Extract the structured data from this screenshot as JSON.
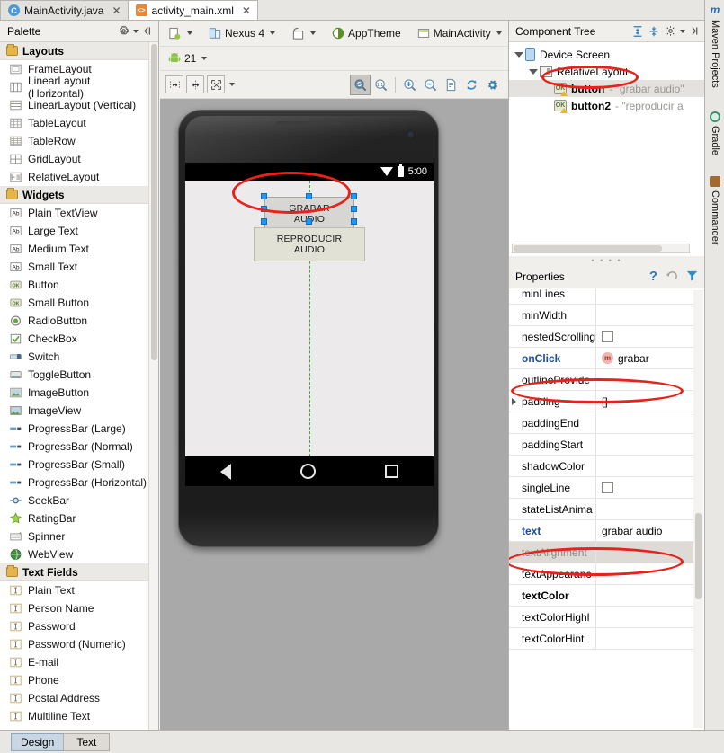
{
  "tabs": [
    {
      "label": "MainActivity.java",
      "icon": "java-class-icon",
      "glyph": "C",
      "active": false
    },
    {
      "label": "activity_main.xml",
      "icon": "xml-file-icon",
      "glyph": "<>",
      "active": true
    }
  ],
  "palette": {
    "title": "Palette",
    "groups": [
      {
        "label": "Layouts",
        "items": [
          {
            "label": "FrameLayout",
            "icon": "frame-layout-icon"
          },
          {
            "label": "LinearLayout (Horizontal)",
            "icon": "linear-layout-horizontal-icon"
          },
          {
            "label": "LinearLayout (Vertical)",
            "icon": "linear-layout-vertical-icon"
          },
          {
            "label": "TableLayout",
            "icon": "table-layout-icon"
          },
          {
            "label": "TableRow",
            "icon": "table-row-icon"
          },
          {
            "label": "GridLayout",
            "icon": "grid-layout-icon"
          },
          {
            "label": "RelativeLayout",
            "icon": "relative-layout-icon"
          }
        ]
      },
      {
        "label": "Widgets",
        "items": [
          {
            "label": "Plain TextView",
            "icon": "text-ab-icon"
          },
          {
            "label": "Large Text",
            "icon": "text-ab-icon"
          },
          {
            "label": "Medium Text",
            "icon": "text-ab-icon"
          },
          {
            "label": "Small Text",
            "icon": "text-ab-icon"
          },
          {
            "label": "Button",
            "icon": "button-ok-icon"
          },
          {
            "label": "Small Button",
            "icon": "button-ok-icon"
          },
          {
            "label": "RadioButton",
            "icon": "radio-button-icon"
          },
          {
            "label": "CheckBox",
            "icon": "checkbox-icon"
          },
          {
            "label": "Switch",
            "icon": "switch-icon"
          },
          {
            "label": "ToggleButton",
            "icon": "toggle-button-icon"
          },
          {
            "label": "ImageButton",
            "icon": "image-button-icon"
          },
          {
            "label": "ImageView",
            "icon": "image-view-icon"
          },
          {
            "label": "ProgressBar (Large)",
            "icon": "progress-bar-icon"
          },
          {
            "label": "ProgressBar (Normal)",
            "icon": "progress-bar-icon"
          },
          {
            "label": "ProgressBar (Small)",
            "icon": "progress-bar-icon"
          },
          {
            "label": "ProgressBar (Horizontal)",
            "icon": "progress-bar-icon"
          },
          {
            "label": "SeekBar",
            "icon": "seek-bar-icon"
          },
          {
            "label": "RatingBar",
            "icon": "rating-bar-icon"
          },
          {
            "label": "Spinner",
            "icon": "spinner-icon"
          },
          {
            "label": "WebView",
            "icon": "web-view-icon"
          }
        ]
      },
      {
        "label": "Text Fields",
        "items": [
          {
            "label": "Plain Text",
            "icon": "text-field-icon"
          },
          {
            "label": "Person Name",
            "icon": "text-field-icon"
          },
          {
            "label": "Password",
            "icon": "text-field-icon"
          },
          {
            "label": "Password (Numeric)",
            "icon": "text-field-icon"
          },
          {
            "label": "E-mail",
            "icon": "text-field-icon"
          },
          {
            "label": "Phone",
            "icon": "text-field-icon"
          },
          {
            "label": "Postal Address",
            "icon": "text-field-icon"
          },
          {
            "label": "Multiline Text",
            "icon": "text-field-icon"
          }
        ]
      }
    ]
  },
  "toolbar": {
    "device": "Nexus 4",
    "theme": "AppTheme",
    "activity": "MainActivity",
    "api_level": "21",
    "icons": {
      "config": "device-config-icon",
      "device": "device-icon",
      "orientation": "orientation-icon",
      "theme": "theme-contrast-icon",
      "activity": "activity-icon",
      "locale": "globe-icon",
      "api": "android-robot-icon"
    },
    "align_buttons": [
      "align-distribute-icon",
      "align-center-icon",
      "expand-icon"
    ],
    "zoom_buttons": [
      {
        "icon": "zoom-fit-icon",
        "selected": true
      },
      {
        "icon": "zoom-actual-size-icon",
        "selected": false
      },
      {
        "icon": "zoom-in-icon",
        "selected": false
      },
      {
        "icon": "zoom-out-icon",
        "selected": false
      },
      {
        "icon": "document-icon",
        "selected": false
      },
      {
        "icon": "refresh-icon",
        "selected": false
      },
      {
        "icon": "settings-gear-icon",
        "selected": false
      }
    ]
  },
  "preview": {
    "status_time": "5:00",
    "buttons": [
      {
        "label": "GRABAR AUDIO",
        "selected": true
      },
      {
        "label": "REPRODUCIR AUDIO",
        "selected": false
      }
    ],
    "nav": [
      "back-icon",
      "home-icon",
      "recents-icon"
    ]
  },
  "component_tree": {
    "title": "Component Tree",
    "icons": [
      "expand-all-icon",
      "collapse-all-icon",
      "settings-gear-icon",
      "hide-panel-icon"
    ],
    "nodes": [
      {
        "name": "Device Screen",
        "value": "",
        "indent": 0,
        "icon": "device-screen-icon",
        "expander": true,
        "selected": false,
        "bold": false
      },
      {
        "name": "RelativeLayout",
        "value": "",
        "indent": 1,
        "icon": "relative-layout-icon",
        "expander": true,
        "selected": false,
        "bold": false
      },
      {
        "name": "button",
        "value": "- \"grabar audio\"",
        "indent": 2,
        "icon": "button-ok-warn-icon",
        "expander": false,
        "selected": true,
        "bold": true
      },
      {
        "name": "button2",
        "value": "- \"reproducir a",
        "indent": 2,
        "icon": "button-ok-warn-icon",
        "expander": false,
        "selected": false,
        "bold": true
      }
    ]
  },
  "properties": {
    "title": "Properties",
    "icons": [
      "help-icon",
      "restore-default-icon",
      "filter-icon"
    ],
    "rows": [
      {
        "name": "minLines",
        "value": "",
        "type": "text",
        "style": "normal"
      },
      {
        "name": "minWidth",
        "value": "",
        "type": "text",
        "style": "normal"
      },
      {
        "name": "nestedScrolling",
        "value": "",
        "type": "checkbox",
        "style": "normal"
      },
      {
        "name": "onClick",
        "value": "grabar",
        "type": "method",
        "style": "link"
      },
      {
        "name": "outlineProvide",
        "value": "",
        "type": "text",
        "style": "normal"
      },
      {
        "name": "padding",
        "value": "[]",
        "type": "expandable",
        "style": "normal"
      },
      {
        "name": "paddingEnd",
        "value": "",
        "type": "text",
        "style": "normal"
      },
      {
        "name": "paddingStart",
        "value": "",
        "type": "text",
        "style": "normal"
      },
      {
        "name": "shadowColor",
        "value": "",
        "type": "text",
        "style": "normal"
      },
      {
        "name": "singleLine",
        "value": "",
        "type": "checkbox",
        "style": "normal"
      },
      {
        "name": "stateListAnima",
        "value": "",
        "type": "text",
        "style": "normal"
      },
      {
        "name": "text",
        "value": "grabar audio",
        "type": "text",
        "style": "link"
      },
      {
        "name": "textAlignment",
        "value": "",
        "type": "text",
        "style": "greyed"
      },
      {
        "name": "textAppearanc",
        "value": "",
        "type": "text",
        "style": "normal"
      },
      {
        "name": "textColor",
        "value": "",
        "type": "text",
        "style": "bold"
      },
      {
        "name": "textColorHighl",
        "value": "",
        "type": "text",
        "style": "normal"
      },
      {
        "name": "textColorHint",
        "value": "",
        "type": "text",
        "style": "normal"
      }
    ]
  },
  "tool_tabs": [
    {
      "label": "Maven Projects",
      "icon": "maven-icon"
    },
    {
      "label": "Gradle",
      "icon": "gradle-icon"
    },
    {
      "label": "Commander",
      "icon": "commander-icon"
    }
  ],
  "bottom_tabs": [
    {
      "label": "Design",
      "active": true
    },
    {
      "label": "Text",
      "active": false
    }
  ],
  "annotation_color": "#e8211a"
}
